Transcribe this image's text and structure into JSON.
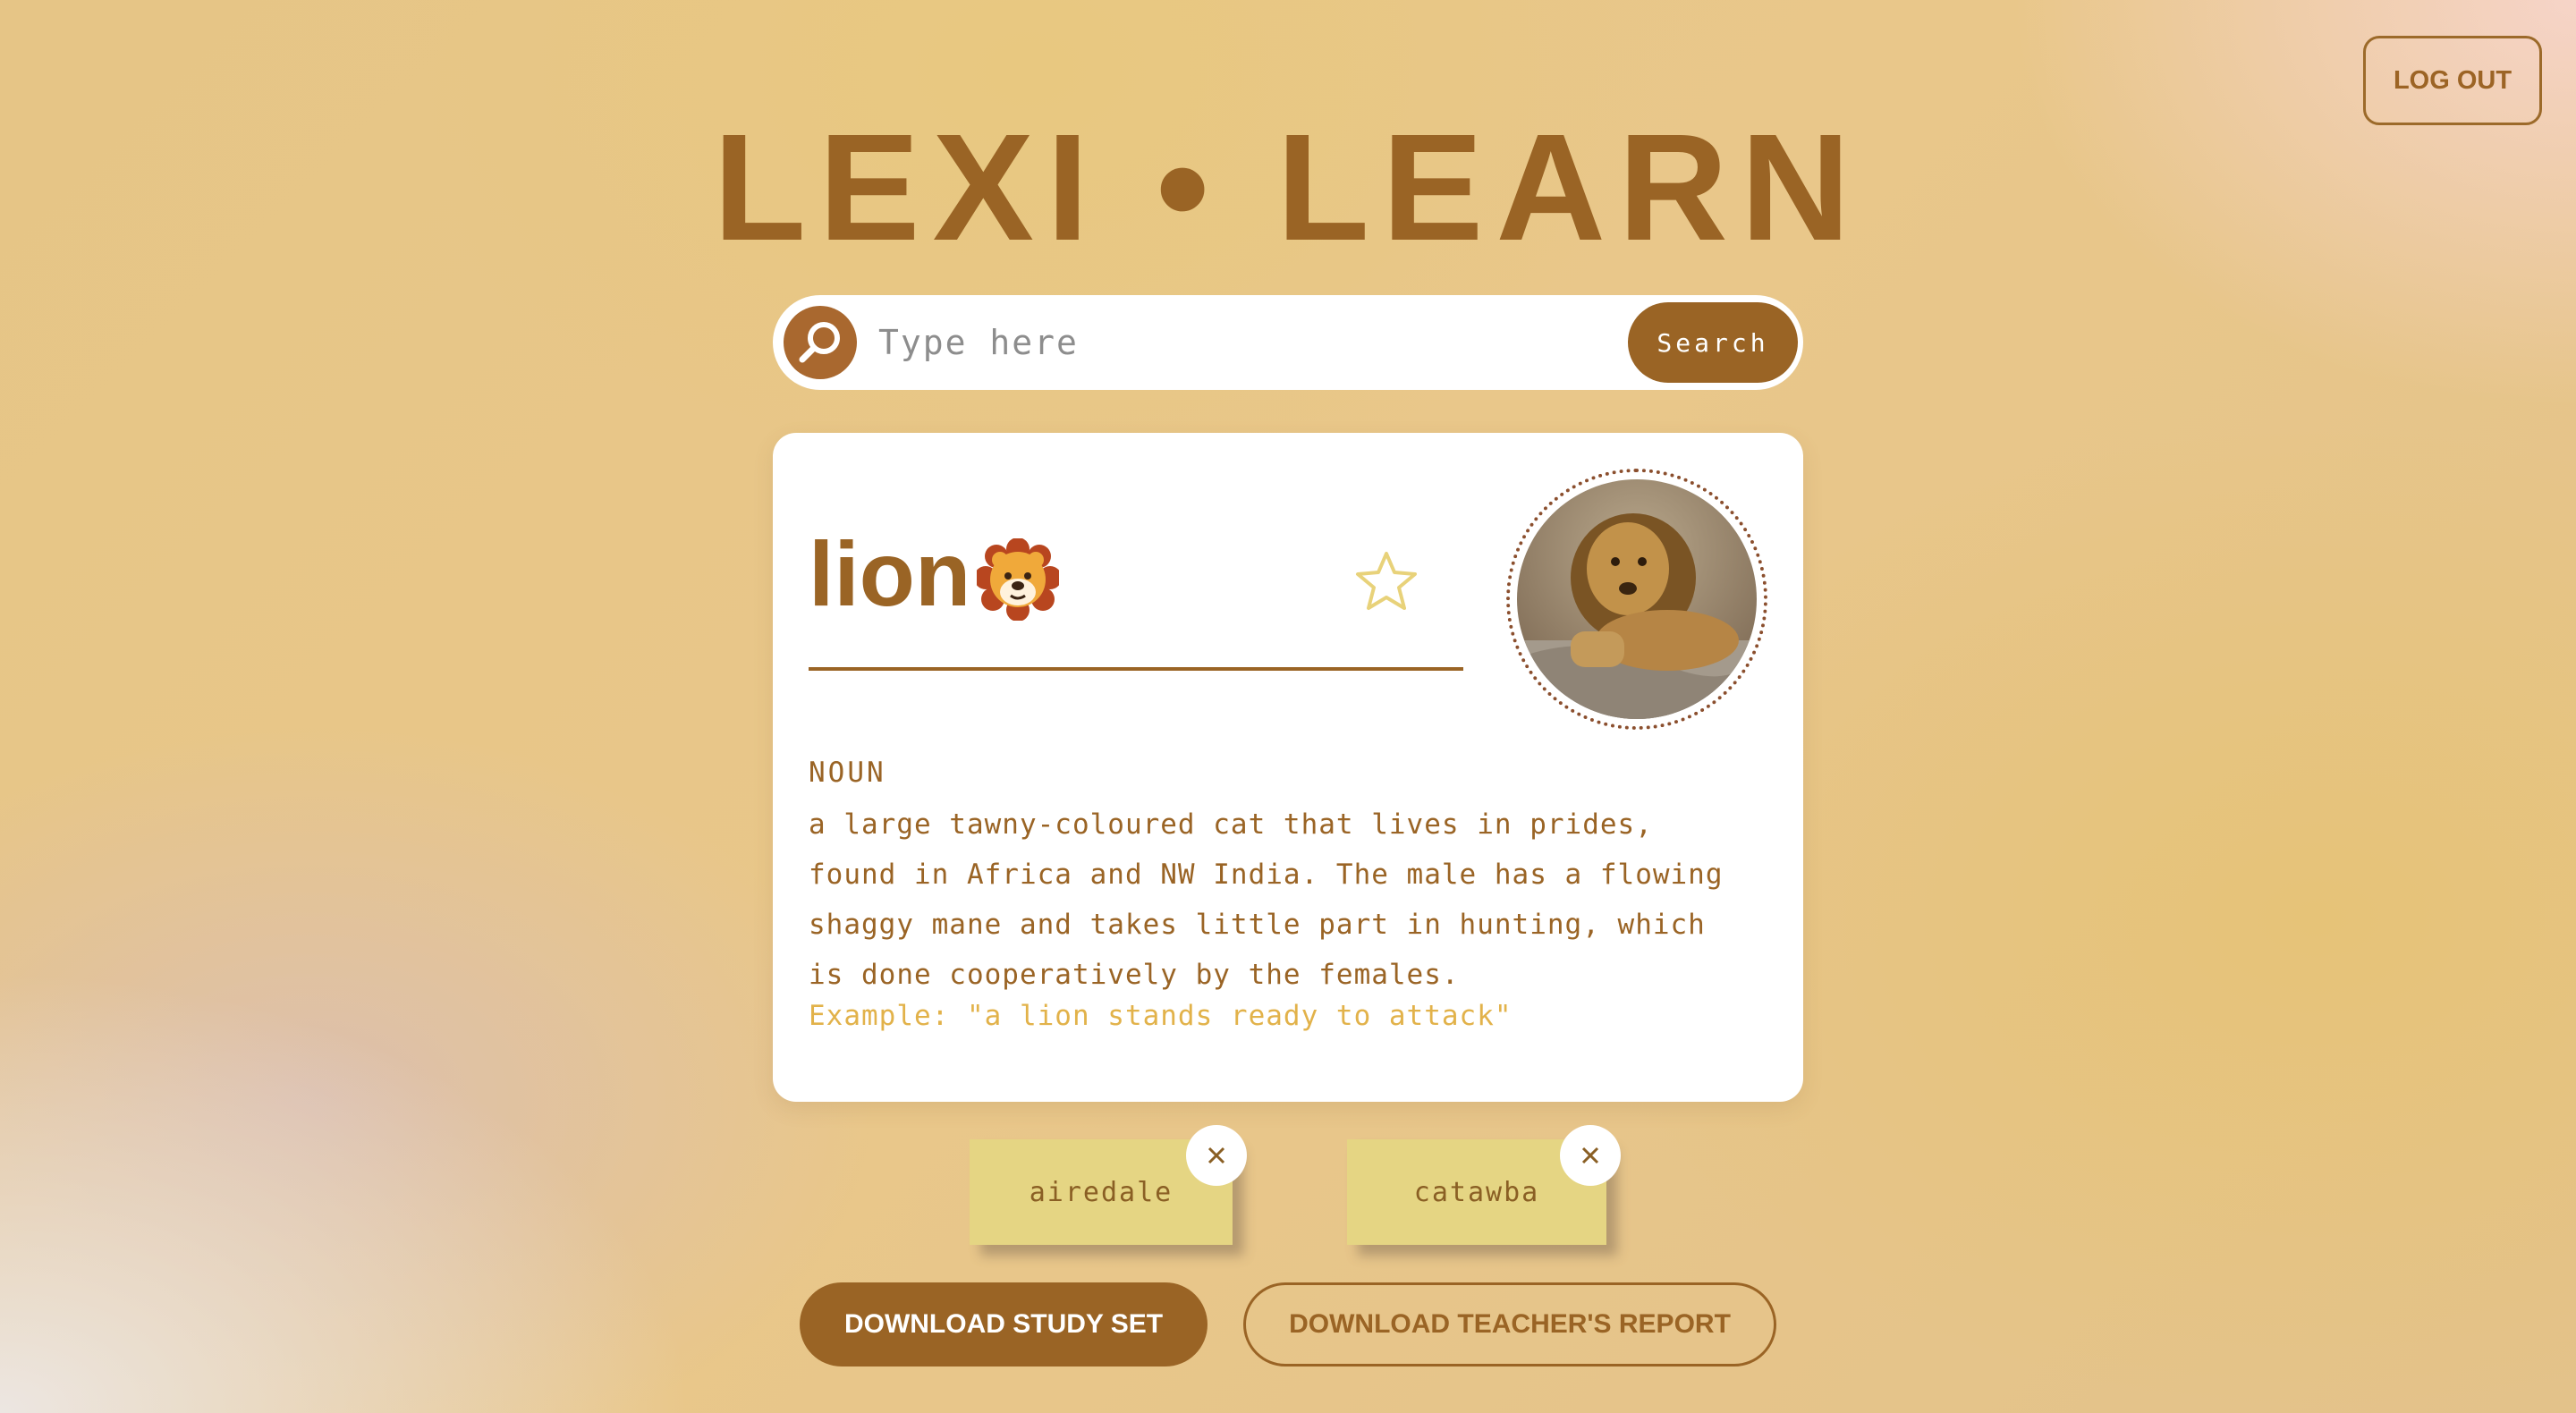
{
  "header": {
    "logout_label": "LOG OUT"
  },
  "app": {
    "title": "LEXI • LEARN"
  },
  "search": {
    "placeholder": "Type here",
    "button_label": "Search",
    "icon": "search-icon"
  },
  "entry": {
    "word": "lion",
    "emoji": "lion-face-icon",
    "favorite_icon": "star-icon",
    "part_of_speech": "NOUN",
    "definition": "a large tawny-coloured cat that lives in prides, found in Africa and NW India. The male has a flowing shaggy mane and takes little part in hunting, which is done cooperatively by the females.",
    "example": "Example: \"a lion stands ready to attack\""
  },
  "saved_words": [
    {
      "label": "airedale",
      "remove_icon": "close-icon"
    },
    {
      "label": "catawba",
      "remove_icon": "close-icon"
    }
  ],
  "actions": {
    "download_study_set": "DOWNLOAD STUDY SET",
    "download_teacher_report": "DOWNLOAD TEACHER'S REPORT"
  },
  "colors": {
    "brand_brown": "#9a6425",
    "star_yellow": "#e8d27a",
    "chip_yellow": "#e5d583",
    "example_yellow": "#e2b24a"
  }
}
